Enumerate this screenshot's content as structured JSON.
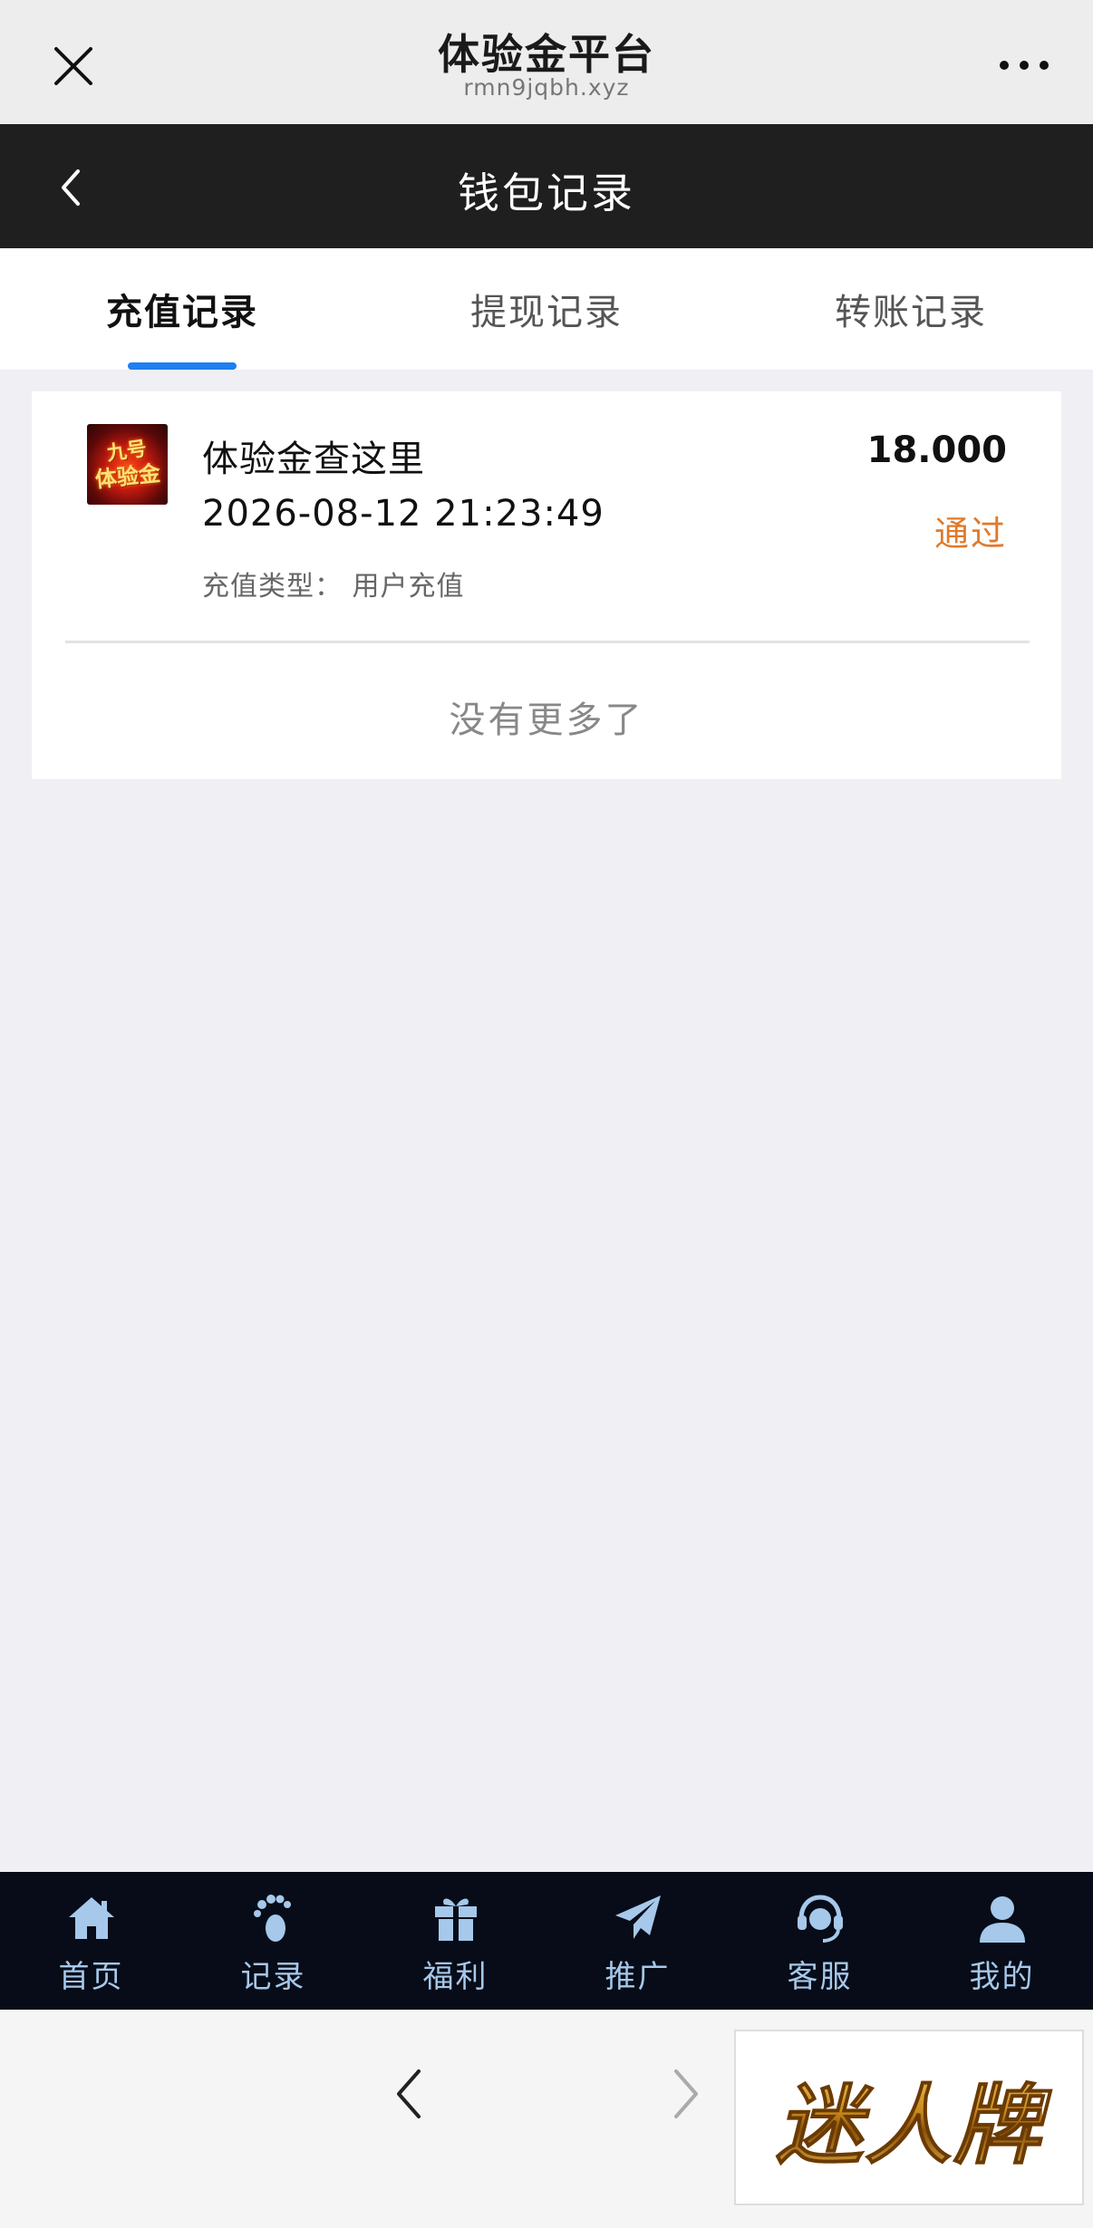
{
  "browser": {
    "title": "体验金平台",
    "url": "rmn9jqbh.xyz"
  },
  "header": {
    "title": "钱包记录"
  },
  "tabs": [
    {
      "label": "充值记录",
      "active": true
    },
    {
      "label": "提现记录",
      "active": false
    },
    {
      "label": "转账记录",
      "active": false
    }
  ],
  "records": [
    {
      "logo_text": [
        "九号",
        "体验金"
      ],
      "name": "体验金查这里",
      "time": "2026-08-12 21:23:49",
      "type_label": "充值类型：",
      "type_value": "用户充值",
      "type_full": "充值类型：  用户充值",
      "amount": "18.000",
      "status": "通过",
      "status_color": "#e07a2a"
    }
  ],
  "list_end_text": "没有更多了",
  "bottom_nav": [
    {
      "label": "首页",
      "icon": "home-icon"
    },
    {
      "label": "记录",
      "icon": "footprint-icon"
    },
    {
      "label": "福利",
      "icon": "gift-icon"
    },
    {
      "label": "推广",
      "icon": "paper-plane-icon"
    },
    {
      "label": "客服",
      "icon": "headset-icon"
    },
    {
      "label": "我的",
      "icon": "user-icon"
    }
  ],
  "ad": {
    "text": "迷人牌"
  },
  "colors": {
    "tab_indicator": "#1d7ff0",
    "header_bg": "#1f1f1f",
    "nav_bg": "#070c18",
    "nav_icon": "#a6c8ea"
  }
}
